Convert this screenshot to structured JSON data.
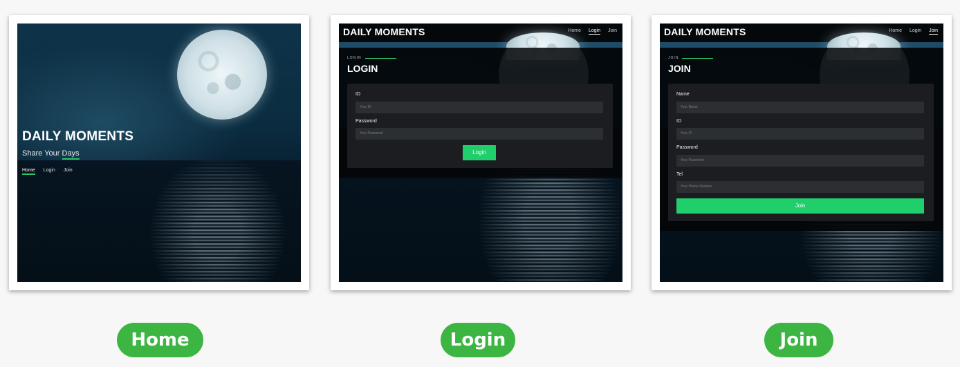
{
  "home": {
    "title": "DAILY MOMENTS",
    "subtitle_part1": "Share Your ",
    "subtitle_part2": "Days",
    "nav": [
      "Home",
      "Login",
      "Join"
    ]
  },
  "login": {
    "brand": "DAILY MOMENTS",
    "nav": [
      "Home",
      "Login",
      "Join"
    ],
    "crumb": "LOGIN",
    "title": "LOGIN",
    "fields": [
      {
        "label": "ID",
        "placeholder": "Your ID"
      },
      {
        "label": "Password",
        "placeholder": "Your Password"
      }
    ],
    "button": "Login"
  },
  "join": {
    "brand": "DAILY MOMENTS",
    "nav": [
      "Home",
      "Login",
      "Join"
    ],
    "crumb": "JOIN",
    "title": "JOIN",
    "fields": [
      {
        "label": "Name",
        "placeholder": "Your Name"
      },
      {
        "label": "ID",
        "placeholder": "Your ID"
      },
      {
        "label": "Password",
        "placeholder": "Your Password"
      },
      {
        "label": "Tel",
        "placeholder": "Your Phone Number"
      }
    ],
    "button": "Join"
  },
  "captions": [
    "Home",
    "Login",
    "Join"
  ],
  "colors": {
    "accent": "#20cf6c",
    "caption_bg": "#3db542",
    "background": "#f7f7f7"
  }
}
